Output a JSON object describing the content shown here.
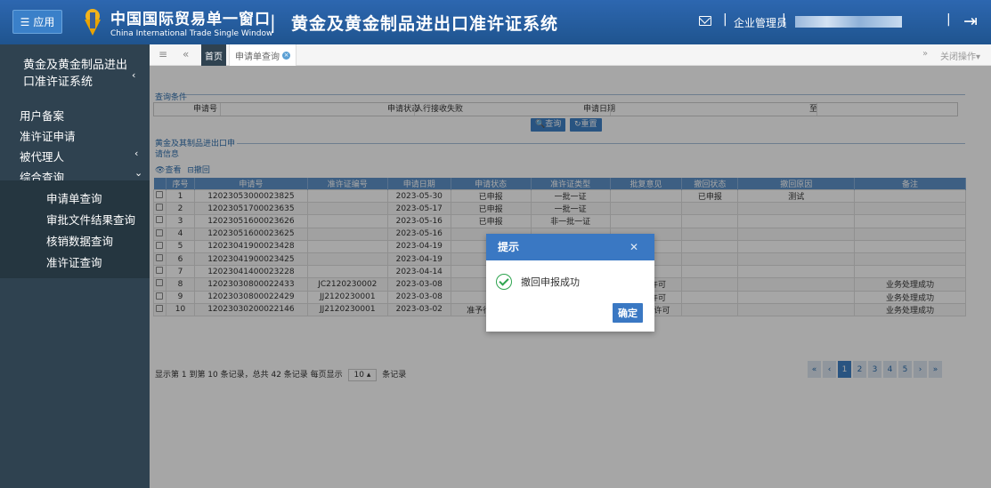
{
  "header": {
    "app_label": "应用",
    "brand_cn": "中国国际贸易单一窗口",
    "brand_en": "China International Trade Single Window",
    "system_title": "黄金及黄金制品进出口准许证系统",
    "separator": "|",
    "role": "企业管理员"
  },
  "sidebar": {
    "title": "黄金及黄金制品进出口准许证系统",
    "items": [
      {
        "label": "用户备案"
      },
      {
        "label": "准许证申请"
      },
      {
        "label": "被代理人"
      },
      {
        "label": "综合查询"
      }
    ],
    "subitems": [
      {
        "label": "申请单查询"
      },
      {
        "label": "审批文件结果查询"
      },
      {
        "label": "核销数据查询"
      },
      {
        "label": "准许证查询"
      }
    ]
  },
  "tabs": {
    "home": "首页",
    "current": "申请单查询",
    "close_ops": "关闭操作"
  },
  "query": {
    "section": "查询条件",
    "apply_no": "申请号",
    "status_label": "申请状态",
    "status_value": "人行接收失败",
    "date_label": "申请日期",
    "to": "至",
    "search_btn": "查询",
    "reset_btn": "重置"
  },
  "list": {
    "section_line1": "黄金及其制品进出口申",
    "section_line2": "请信息",
    "view_btn": "查看",
    "withdraw_btn": "撤回",
    "headers": [
      "序号",
      "申请号",
      "准许证编号",
      "申请日期",
      "申请状态",
      "准许证类型",
      "批复意见",
      "撤回状态",
      "撤回原因",
      "备注"
    ],
    "rows": [
      [
        "1",
        "12023053000023825",
        "",
        "2023-05-30",
        "已申报",
        "一批一证",
        "",
        "已申报",
        "测试",
        ""
      ],
      [
        "2",
        "12023051700023635",
        "",
        "2023-05-17",
        "已申报",
        "一批一证",
        "",
        "",
        "",
        ""
      ],
      [
        "3",
        "12023051600023626",
        "",
        "2023-05-16",
        "已申报",
        "非一批一证",
        "",
        "",
        "",
        ""
      ],
      [
        "4",
        "12023051600023625",
        "",
        "2023-05-16",
        "",
        "",
        "",
        "",
        "",
        ""
      ],
      [
        "5",
        "12023041900023428",
        "",
        "2023-04-19",
        "",
        "",
        "",
        "",
        "",
        ""
      ],
      [
        "6",
        "12023041900023425",
        "",
        "2023-04-19",
        "",
        "",
        "",
        "",
        "",
        ""
      ],
      [
        "7",
        "12023041400023228",
        "",
        "2023-04-14",
        "",
        "",
        "",
        "",
        "",
        ""
      ],
      [
        "8",
        "12023030800022433",
        "JC2120230002",
        "2023-03-08",
        "",
        "",
        "予行政许可",
        "",
        "",
        "业务处理成功"
      ],
      [
        "9",
        "12023030800022429",
        "JJ2120230001",
        "2023-03-08",
        "",
        "",
        "予行政许可",
        "",
        "",
        "业务处理成功"
      ],
      [
        "10",
        "12023030200022146",
        "JJ2120230001",
        "2023-03-02",
        "准予行政许可",
        "一批一证",
        "准予行政许可",
        "",
        "",
        "业务处理成功"
      ]
    ]
  },
  "pager": {
    "text": "显示第 1 到第 10 条记录，总共 42 条记录 每页显示",
    "size": "10",
    "suffix": "条记录",
    "pages": [
      "«",
      "‹",
      "1",
      "2",
      "3",
      "4",
      "5",
      "›",
      "»"
    ]
  },
  "dialog": {
    "title": "提示",
    "message": "撤回申报成功",
    "ok": "确定"
  },
  "colors": {
    "header": "#2d67b0",
    "sidebar": "#2f4250",
    "accent": "#3a78c3",
    "success": "#2ea44f"
  }
}
